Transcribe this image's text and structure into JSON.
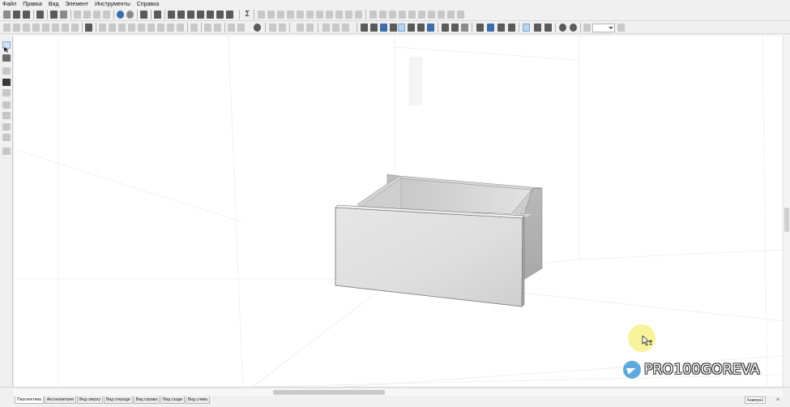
{
  "menu": {
    "items": [
      "Файл",
      "Правка",
      "Вид",
      "Элемент",
      "Инструменты",
      "Справка"
    ]
  },
  "toolbar": {
    "sigma_label": "Σ",
    "zoom_value": ""
  },
  "left_tools": {
    "selected": "select-arrow-tool"
  },
  "view_tabs": {
    "items": [
      "Перспектива",
      "Аксонометрия",
      "Вид сверху",
      "Вид спереди",
      "Вид справа",
      "Вид сзади",
      "Вид слева"
    ],
    "active": "Перспектива"
  },
  "camera": {
    "label": "Камера1",
    "close_glyph": "×"
  },
  "watermark": {
    "text": "PRO100GOREVA",
    "icon": "telegram-icon"
  },
  "colors": {
    "accent_blue": "#3b6ea8",
    "highlight_yellow": "#f5ed78",
    "telegram_blue": "#5fa9dd"
  }
}
